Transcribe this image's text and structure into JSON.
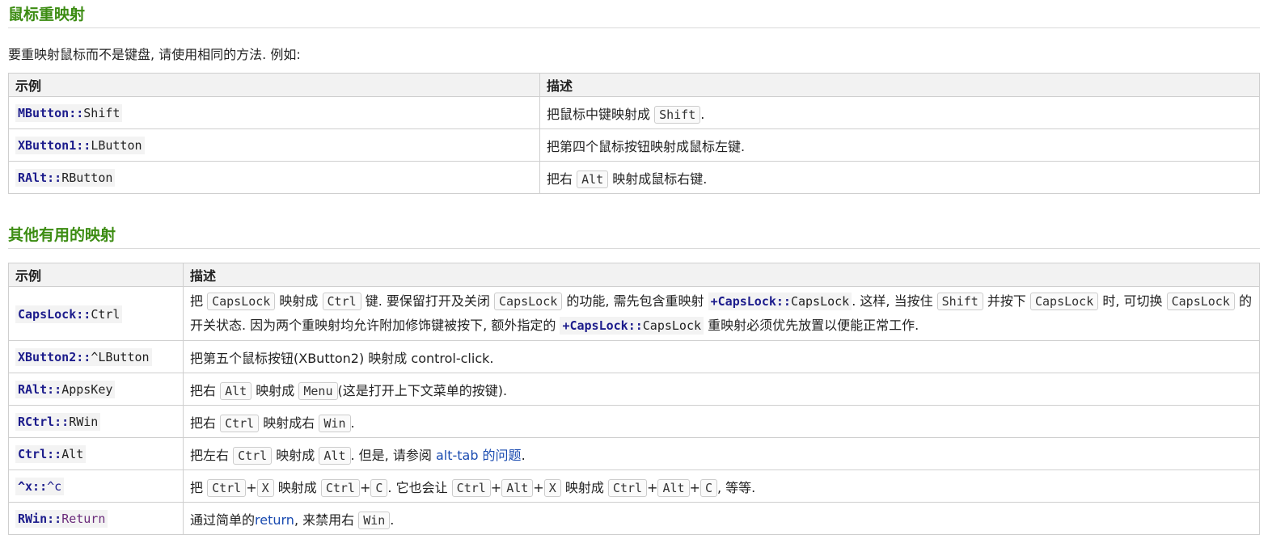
{
  "section1": {
    "title": "鼠标重映射",
    "intro": "要重映射鼠标而不是键盘, 请使用相同的方法. 例如:",
    "headers": [
      "示例",
      "描述"
    ],
    "rows": [
      {
        "ex": {
          "a": "MButton::",
          "b": "Shift"
        },
        "desc": {
          "p1": "把鼠标中键映射成 ",
          "k1": "Shift",
          "p2": "."
        }
      },
      {
        "ex": {
          "a": "XButton1::",
          "b": "LButton"
        },
        "desc": {
          "p1": "把第四个鼠标按钮映射成鼠标左键."
        }
      },
      {
        "ex": {
          "a": "RAlt::",
          "b": "RButton"
        },
        "desc": {
          "p1": "把右 ",
          "k1": "Alt",
          "p2": " 映射成鼠标右键."
        }
      }
    ]
  },
  "section2": {
    "title": "其他有用的映射",
    "headers": [
      "示例",
      "描述"
    ],
    "rows": [
      {
        "ex": {
          "a": "CapsLock::",
          "b": "Ctrl"
        },
        "desc": {
          "t1": "把 ",
          "k1": "CapsLock",
          "t2": " 映射成 ",
          "k2": "Ctrl",
          "t3": " 键. 要保留打开及关闭 ",
          "k3": "CapsLock",
          "t4": " 的功能, 需先包含重映射 ",
          "c1a": "+CapsLock::",
          "c1b": "CapsLock",
          "t5": ". 这样, 当按住 ",
          "k4": "Shift",
          "t6": " 并按下 ",
          "k5": "CapsLock",
          "t7": " 时, 可切换 ",
          "k6": "CapsLock",
          "t8": " 的开关状态. 因为两个重映射均允许附加修饰键被按下, 额外指定的 ",
          "c2a": "+CapsLock::",
          "c2b": "CapsLock",
          "t9": " 重映射必须优先放置以便能正常工作."
        }
      },
      {
        "ex": {
          "a": "XButton2::",
          "b": "^LButton"
        },
        "desc": {
          "t1": "把第五个鼠标按钮(XButton2) 映射成 control-click."
        }
      },
      {
        "ex": {
          "a": "RAlt::",
          "b": "AppsKey"
        },
        "desc": {
          "t1": "把右 ",
          "k1": "Alt",
          "t2": " 映射成 ",
          "k2": "Menu",
          "t3": "(这是打开上下文菜单的按键)."
        }
      },
      {
        "ex": {
          "a": "RCtrl::",
          "b": "RWin"
        },
        "desc": {
          "t1": "把右 ",
          "k1": "Ctrl",
          "t2": " 映射成右 ",
          "k2": "Win",
          "t3": "."
        }
      },
      {
        "ex": {
          "a": "Ctrl::",
          "b": "Alt"
        },
        "desc": {
          "t1": "把左右 ",
          "k1": "Ctrl",
          "t2": " 映射成 ",
          "k2": "Alt",
          "t3": ". 但是, 请参阅 ",
          "link": "alt-tab 的问题",
          "t4": "."
        }
      },
      {
        "ex": {
          "a": "^x::",
          "b": "^c"
        },
        "desc": {
          "t1": "把 ",
          "k1": "Ctrl",
          "p1": "+",
          "k2": "X",
          "t2": " 映射成 ",
          "k3": "Ctrl",
          "p2": "+",
          "k4": "C",
          "t3": ". 它也会让 ",
          "k5": "Ctrl",
          "p3": "+",
          "k6": "Alt",
          "p4": "+",
          "k7": "X",
          "t4": " 映射成 ",
          "k8": "Ctrl",
          "p5": "+",
          "k9": "Alt",
          "p6": "+",
          "k10": "C",
          "t5": ", 等等."
        }
      },
      {
        "ex": {
          "a": "RWin::",
          "b": "Return"
        },
        "desc": {
          "t1": "通过简单的",
          "link": "return",
          "t2": ", 来禁用右 ",
          "k1": "Win",
          "t3": "."
        }
      }
    ]
  },
  "colors": {
    "heading": "#3c8c12",
    "link": "#1a4bb0",
    "code_keyword": "#1c1c8c",
    "code_return": "#6a2a7a"
  }
}
